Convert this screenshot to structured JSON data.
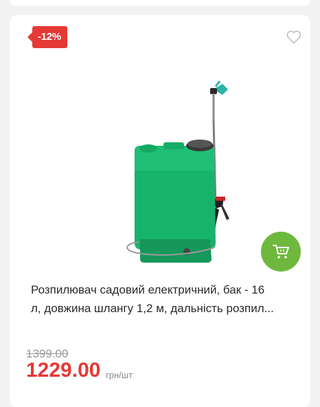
{
  "badge": {
    "discount": "-12%"
  },
  "icons": {
    "favorite": "heart-outline-icon",
    "cart": "shopping-cart-icon"
  },
  "product": {
    "title_line1": "Розпилювач садовий електричний, бак - 16",
    "title_line2": "л, довжина шлангу 1,2 м, дальність розпил...",
    "old_price": "1399.00",
    "price": "1229.00",
    "unit": "грн/шт"
  },
  "colors": {
    "badge": "#e53935",
    "price": "#e53935",
    "cart_button": "#6fb83e"
  }
}
